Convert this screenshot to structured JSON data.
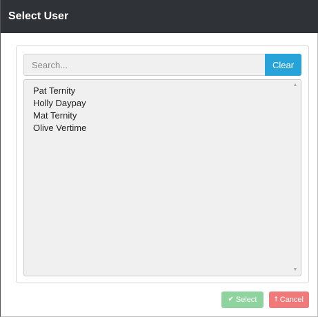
{
  "dialog": {
    "title": "Select User"
  },
  "search": {
    "placeholder": "Search...",
    "value": "",
    "clear_label": "Clear"
  },
  "users": [
    "Pat Ternity",
    "Holly Daypay",
    "Mat Ternity",
    "Olive Vertime"
  ],
  "scroll": {
    "up_icon": "chevron-up-icon",
    "down_icon": "chevron-down-icon"
  },
  "actions": {
    "select_label": "Select",
    "select_icon": "checkmark-icon",
    "cancel_label": "Cancel",
    "cancel_icon": "upload-arrow-icon"
  },
  "colors": {
    "titlebar": "#2f3237",
    "clear_button": "#26a3d9",
    "select_button": "#8fd39e",
    "cancel_button": "#f07a7a",
    "list_background": "#f0f0f0"
  }
}
